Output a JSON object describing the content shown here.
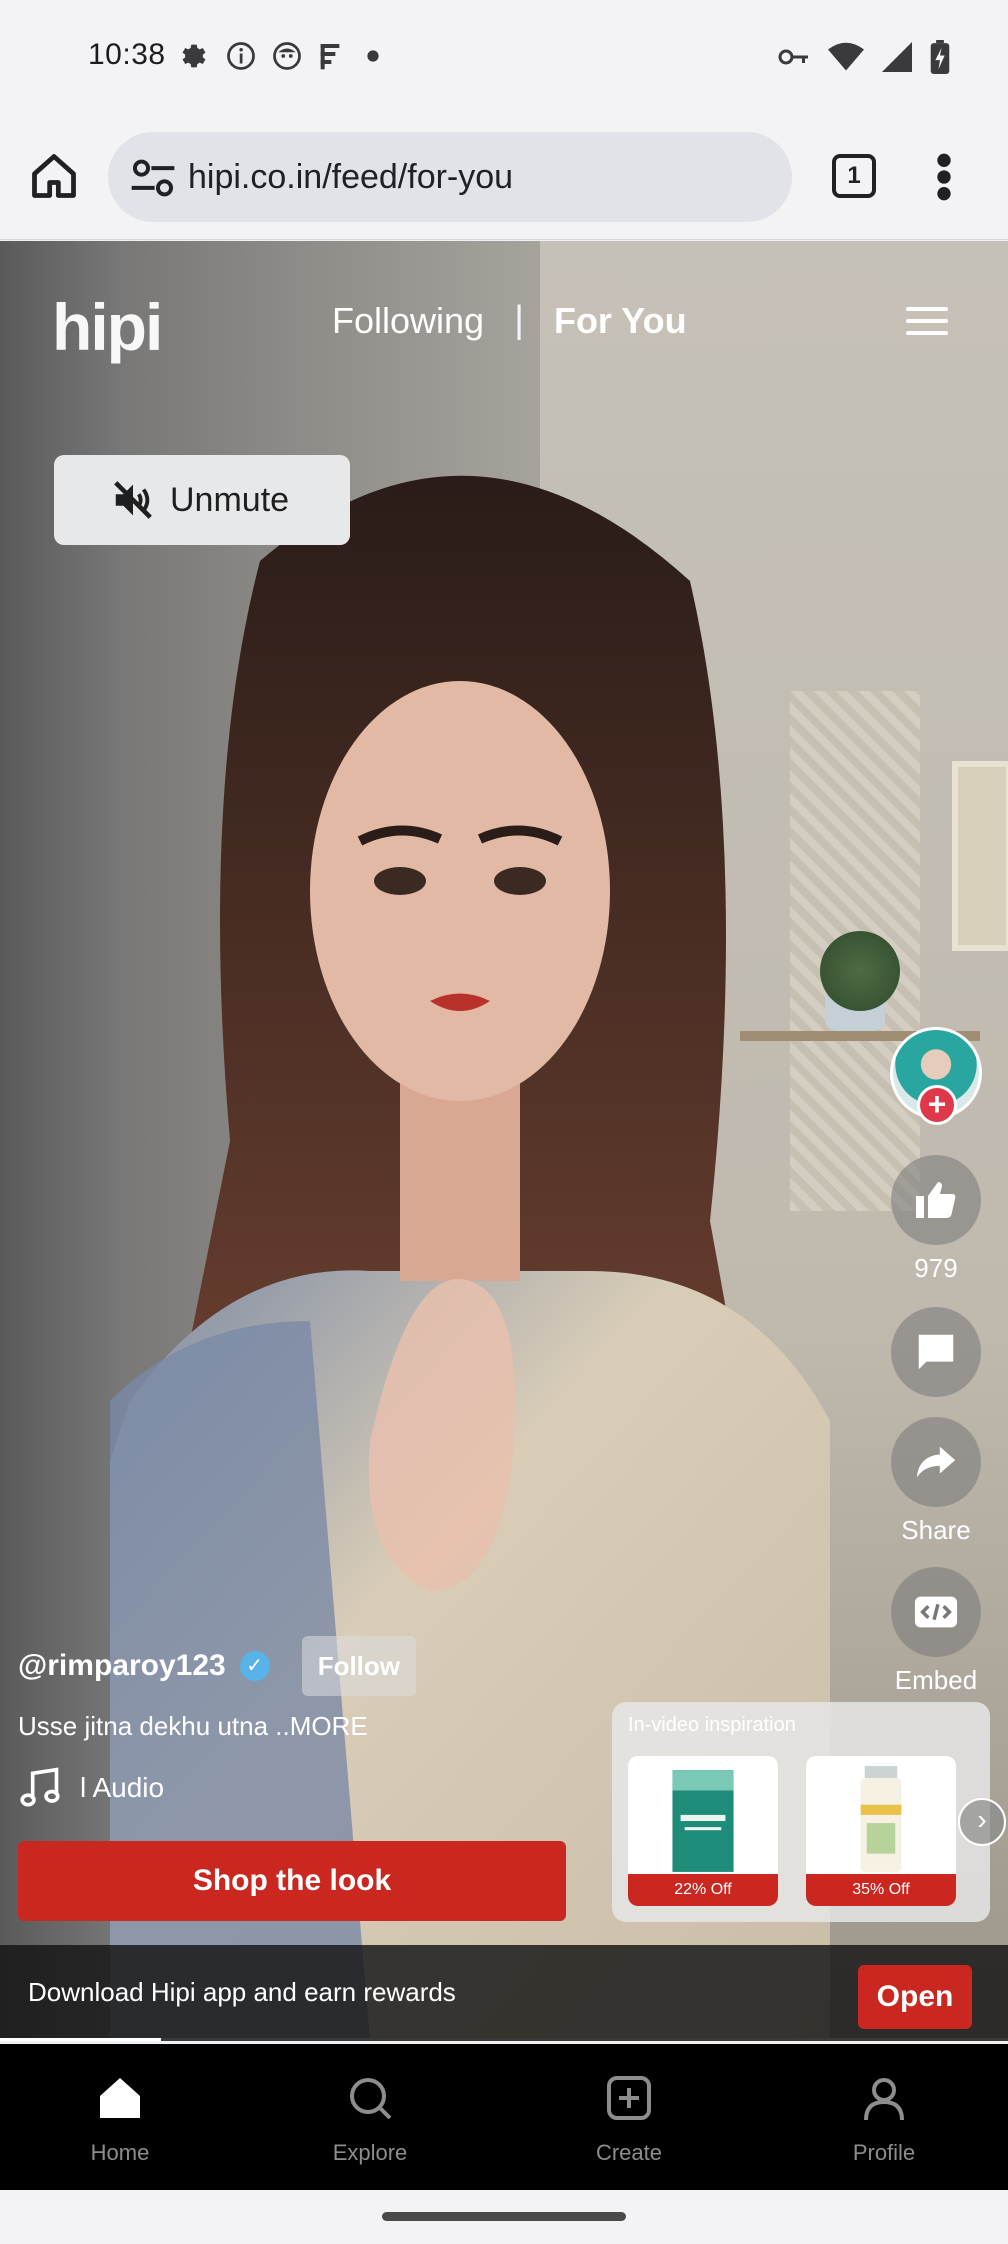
{
  "status_bar": {
    "time": "10:38",
    "icons": [
      "settings-icon",
      "info-icon",
      "smile-icon",
      "signal-bars-icon",
      "dot-icon"
    ],
    "right_icons": [
      "vpn-key-icon",
      "wifi-icon",
      "cellular-icon",
      "battery-icon"
    ]
  },
  "browser": {
    "url": "hipi.co.in/feed/for-you",
    "tab_count": "1"
  },
  "header": {
    "logo": "hipi",
    "tabs": [
      {
        "label": "Following",
        "active": false
      },
      {
        "label": "For You",
        "active": true
      }
    ],
    "separator": "|"
  },
  "video": {
    "unmute_label": "Unmute"
  },
  "actions": {
    "like_count": "979",
    "share_label": "Share",
    "embed_label": "Embed"
  },
  "creator": {
    "handle": "@rimparoy123",
    "follow_label": "Follow",
    "caption": "Usse jitna dekhu utna ..MORE",
    "audio": "l Audio"
  },
  "shop_label": "Shop the look",
  "inspiration": {
    "title": "In-video inspiration",
    "products": [
      {
        "discount": "22% Off",
        "color": "#1f8c7a"
      },
      {
        "discount": "35% Off",
        "color": "#e8c24a"
      }
    ]
  },
  "banner": {
    "text": "Download Hipi app and earn rewards",
    "open_label": "Open",
    "progress_fraction": 0.16
  },
  "bottom_nav": [
    {
      "label": "Home",
      "icon": "home-icon",
      "active": true
    },
    {
      "label": "Explore",
      "icon": "search-icon",
      "active": false
    },
    {
      "label": "Create",
      "icon": "plus-square-icon",
      "active": false
    },
    {
      "label": "Profile",
      "icon": "user-icon",
      "active": false
    }
  ],
  "colors": {
    "accent_red": "#c9271f",
    "follow_plus": "#e0384b",
    "verified_blue": "#58b3e8"
  }
}
